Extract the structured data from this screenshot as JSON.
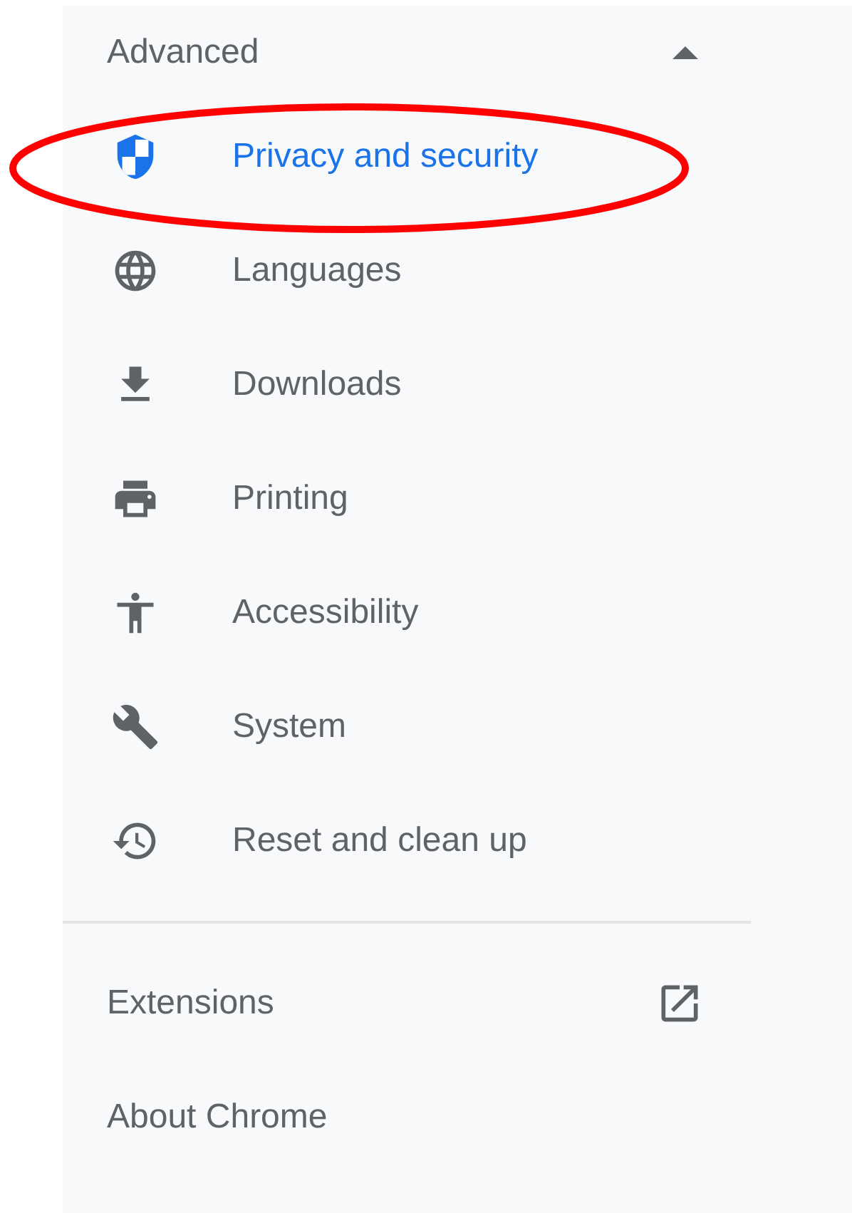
{
  "advanced": {
    "label": "Advanced",
    "expanded": true
  },
  "items": [
    {
      "kind": "shield",
      "label": "Privacy and security",
      "selected": true
    },
    {
      "kind": "globe",
      "label": "Languages",
      "selected": false
    },
    {
      "kind": "download",
      "label": "Downloads",
      "selected": false
    },
    {
      "kind": "printer",
      "label": "Printing",
      "selected": false
    },
    {
      "kind": "accessibility",
      "label": "Accessibility",
      "selected": false
    },
    {
      "kind": "wrench",
      "label": "System",
      "selected": false
    },
    {
      "kind": "history",
      "label": "Reset and clean up",
      "selected": false
    }
  ],
  "links": [
    {
      "label": "Extensions",
      "external": true
    },
    {
      "label": "About Chrome",
      "external": false
    }
  ]
}
